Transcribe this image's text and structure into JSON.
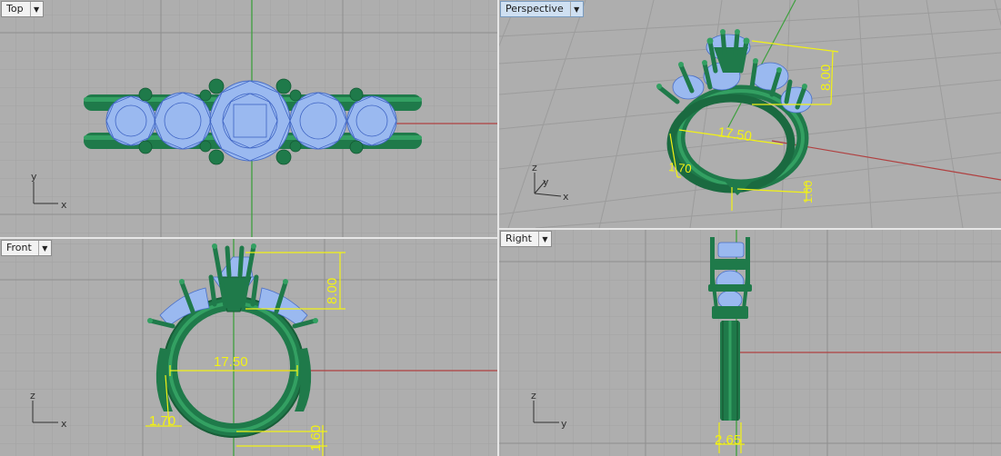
{
  "viewports": {
    "top": {
      "name": "Top",
      "axis_x": "x",
      "axis_y": "y"
    },
    "perspective": {
      "name": "Perspective",
      "axis_x": "x",
      "axis_y": "y",
      "axis_z": "z",
      "dim_width": "17.50",
      "dim_height": "8.00",
      "dim_band": "1.70",
      "dim_shank": "1.60"
    },
    "front": {
      "name": "Front",
      "axis_x": "x",
      "axis_z": "z",
      "dim_width": "17.50",
      "dim_height": "8.00",
      "dim_band": "1.70",
      "dim_shank": "1.60"
    },
    "right": {
      "name": "Right",
      "axis_y": "y",
      "axis_z": "z",
      "dim_thickness": "2.65"
    }
  },
  "colors": {
    "viewport_bg": "#aeaeae",
    "grid_minor": "#a2a2a2",
    "grid_major": "#8e8e8e",
    "x_axis": "#b04040",
    "y_axis": "#3ea03e",
    "metal": "#1f7a4a",
    "metal_light": "#33a062",
    "gem": "#9ab9f0",
    "dimension": "#f2f214"
  }
}
